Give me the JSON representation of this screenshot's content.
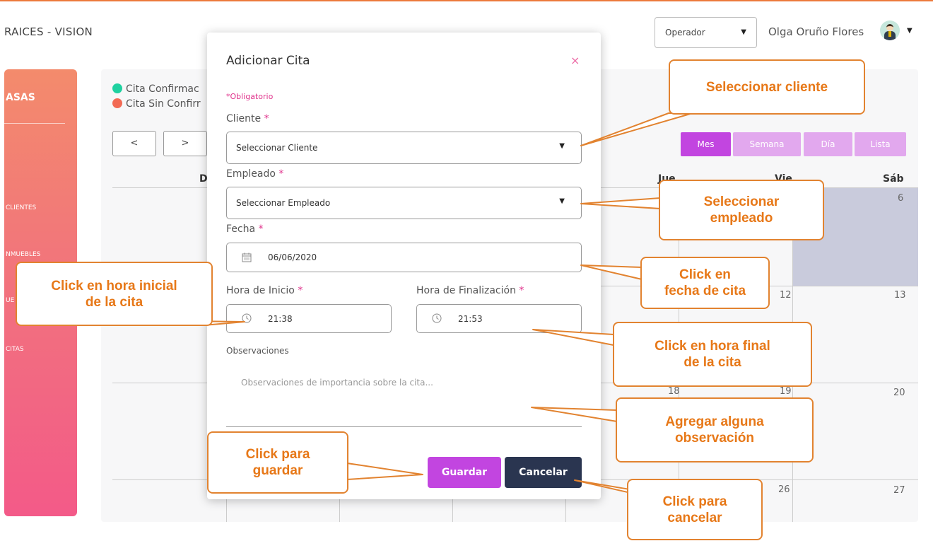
{
  "header": {
    "app_title": "RAICES - VISION",
    "role": "Operador",
    "user_name": "Olga Oruño Flores"
  },
  "sidebar": {
    "heading": "ASAS",
    "items": [
      "CLIENTES",
      "NMUEBLES",
      "UE",
      "CITAS"
    ]
  },
  "legend": {
    "confirmed": "Cita Confirmac",
    "unconfirmed": "Cita Sin Confirr",
    "confirmed_color": "#1fd1a0",
    "unconfirmed_color": "#f26a54"
  },
  "calendar": {
    "prev": "<",
    "next": ">",
    "views": {
      "month": "Mes",
      "week": "Semana",
      "day": "Día",
      "list": "Lista"
    },
    "headers": {
      "sun": "D",
      "thu": "Jue",
      "fri": "Vie",
      "sat": "Sáb"
    },
    "day_numbers": [
      "6",
      "12",
      "13",
      "18",
      "19",
      "20",
      "26",
      "27"
    ]
  },
  "modal": {
    "title": "Adicionar Cita",
    "close": "×",
    "required_note": "Obligatorio",
    "star": "*",
    "client_label": "Cliente",
    "client_value": "Seleccionar Cliente",
    "employee_label": "Empleado",
    "employee_value": "Seleccionar Empleado",
    "date_label": "Fecha",
    "date_value": "06/06/2020",
    "start_label": "Hora de Inicio",
    "start_value": "21:38",
    "end_label": "Hora de Finalización",
    "end_value": "21:53",
    "obs_label": "Observaciones",
    "obs_placeholder": "Observaciones de importancia sobre la cita...",
    "save": "Guardar",
    "cancel": "Cancelar"
  },
  "callouts": {
    "client": "Seleccionar cliente",
    "employee_1": "Seleccionar",
    "employee_2": "empleado",
    "date_1": "Click en",
    "date_2": "fecha de cita",
    "start_1": "Click en hora inicial",
    "start_2": "de la cita",
    "end_1": "Click en hora final",
    "end_2": "de la cita",
    "obs_1": "Agregar alguna",
    "obs_2": "observación",
    "save_1": "Click para",
    "save_2": "guardar",
    "cancel_1": "Click para",
    "cancel_2": "cancelar"
  },
  "colors": {
    "accent_purple": "#c245e0",
    "dark_navy": "#2a3550",
    "callout_orange": "#e77818"
  }
}
